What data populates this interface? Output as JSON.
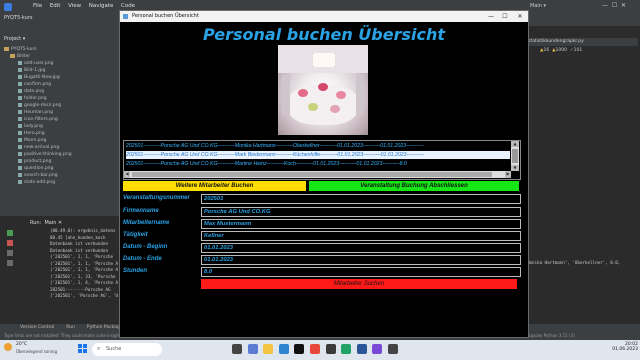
{
  "ide": {
    "project_name": "PYQT5-kurs",
    "menu": [
      "File",
      "Edit",
      "View",
      "Navigate",
      "Code"
    ],
    "project_label": "Project",
    "tree_root": "PYQT5-kurs",
    "tree_folder": "Bilder",
    "files": [
      "add-user.png",
      "Bild-1.jpg",
      "Bugatti-New.jpg",
      "confirm.png",
      "data.png",
      "folder.png",
      "google-docs.png",
      "Heuman.png",
      "icon-filters.png",
      "lady.png",
      "Hero.png",
      "Mann.png",
      "new-arrival.png",
      "positive-thinking.png",
      "product.png",
      "question.png",
      "search-bar.png",
      "stats-add.png"
    ],
    "run_label": "Run:",
    "run_tab": "Main",
    "console_lines": [
      "(80.49.0): ergebnis_datens",
      "80.45 [ohn_kunden_koch",
      "Datenbank ist verbunden",
      "Datenbank ist verbunden",
      "('202501', 1, 1, 'Porsche",
      "('202501', 1, 1, 'Porsche A",
      "('202501', 1, 1, 'Porsche A",
      "('202501', 1, 33, 'Porsche",
      "('202501', 1, 4, 'Porsche A",
      "202501--------Porsche AG",
      "['202501', 'Porsche AG', 'U"
    ],
    "console_right": "Monika Hartmann', 'Oberkellner', 8.0,",
    "right_tab": "statistikkundengrapkr.py",
    "right_values": [
      "16",
      "1000",
      "101"
    ],
    "bottom_tabs": [
      "Version Control",
      "Run",
      "Python Packages",
      "TODO",
      "Python Console",
      "Problems",
      "Terminal",
      "Services"
    ],
    "status_text": "Type hints are not installed: They could make code insight better. // Install 'PyQt5-stubs==5.15.6.0' // Ignore // Edit settings (36 minutes ago)",
    "status_right": "2377:176  CRLF  UTF-8  4 spaces  Python 3.11 (3)"
  },
  "taskbar": {
    "weather_temp": "20°C",
    "weather_desc": "Überwiegend sonnig",
    "search_placeholder": "Suche",
    "time": "20:02",
    "date": "01.06.2023"
  },
  "app": {
    "window_title": "Personal buchen Übersicht",
    "heading": "Personal buchen Übersicht",
    "list_rows": [
      "202501----------Porsche AG  Und CO.KG----------Monika Hartmann----------Oberkellner----------01.01.2023----------01.01.2023----------",
      "202501----------Porsche AG  Und CO.KG----------Mark Biedermann----------Küchenhilfe----------01.01.2023----------01.01.2023----------",
      "202501----------Porsche AG  Und CO.KG----------Martine Heinz----------Koch----------01.01.2023----------01.01.2023----------8.0"
    ],
    "btn_more": "Weitere Mitarbeiter Buchen",
    "btn_complete": "Veranstaltung Buchung Abschliessen",
    "labels": {
      "event_number": "Veranstaltungsnummer",
      "company": "Firmenname",
      "employee": "Mitarbeitername",
      "activity": "Tätigkeit",
      "date_start": "Datum - Beginn",
      "date_end": "Datum - Ende",
      "hours": "Stunden"
    },
    "values": {
      "event_number": "202501",
      "company": "Porsche AG  Und CO.KG",
      "employee": "Max Mustermann",
      "activity": "Kellner",
      "date_start": "01.01.2023",
      "date_end": "01.01.2023",
      "hours": "8.0"
    },
    "btn_search": "Mitarbeiter Suchen"
  }
}
